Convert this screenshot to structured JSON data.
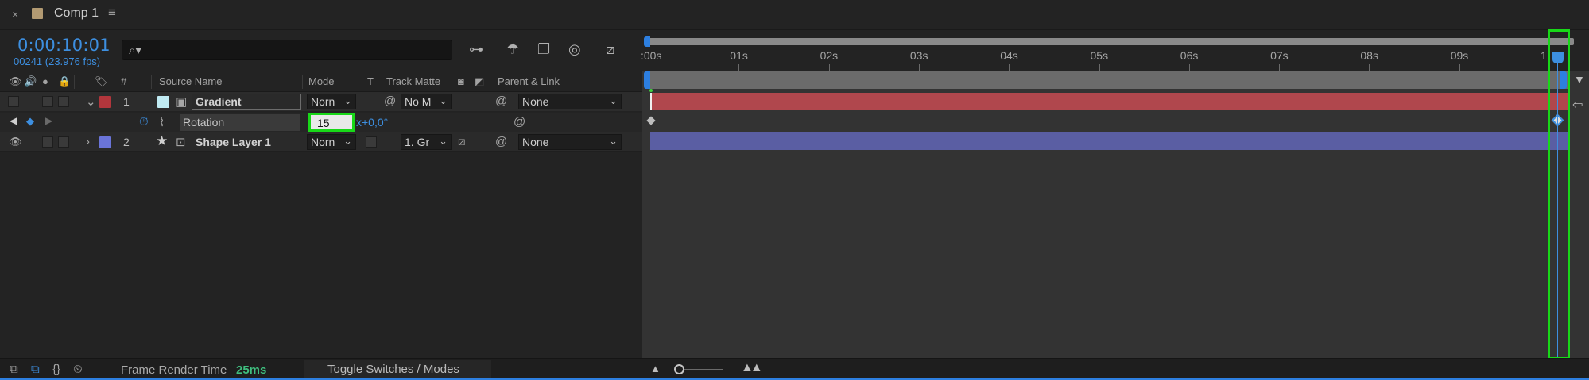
{
  "tab": {
    "close": "×",
    "title": "Comp 1",
    "menu": "≡"
  },
  "header": {
    "timecode": "0:00:10:01",
    "frames": "00241 (23.976 fps)",
    "search_placeholder": "",
    "search_icon": "⌕▾"
  },
  "columns": {
    "mode": "Mode",
    "t": "T",
    "track_matte": "Track Matte",
    "parent_link": "Parent & Link",
    "source_name": "Source Name",
    "hash": "#"
  },
  "layers": [
    {
      "num": "1",
      "name": "Gradient",
      "mode": "Norn",
      "track_matte": "No M",
      "parent": "None",
      "label_color": "#b2363c",
      "twirl": "⌄"
    },
    {
      "num": "2",
      "name": "Shape Layer 1",
      "mode": "Norn",
      "track_matte": "1. Gr",
      "parent": "None",
      "label_color": "#6a74d8",
      "twirl": "›"
    }
  ],
  "property": {
    "name": "Rotation",
    "value": "15",
    "rest": "x+0,0°"
  },
  "footer": {
    "frame_render_label": "Frame Render Time",
    "frame_render_value": "25ms",
    "toggle_label": "Toggle Switches / Modes"
  },
  "timeline": {
    "ticks": [
      ":00s",
      "01s",
      "02s",
      "03s",
      "04s",
      "05s",
      "06s",
      "07s",
      "08s",
      "09s",
      "1"
    ],
    "duration_s": 10
  },
  "colors": {
    "accent": "#3d8fe0",
    "highlight": "#18d818",
    "layer1_bar": "#b0474d",
    "layer2_bar": "#5a5ea3"
  }
}
